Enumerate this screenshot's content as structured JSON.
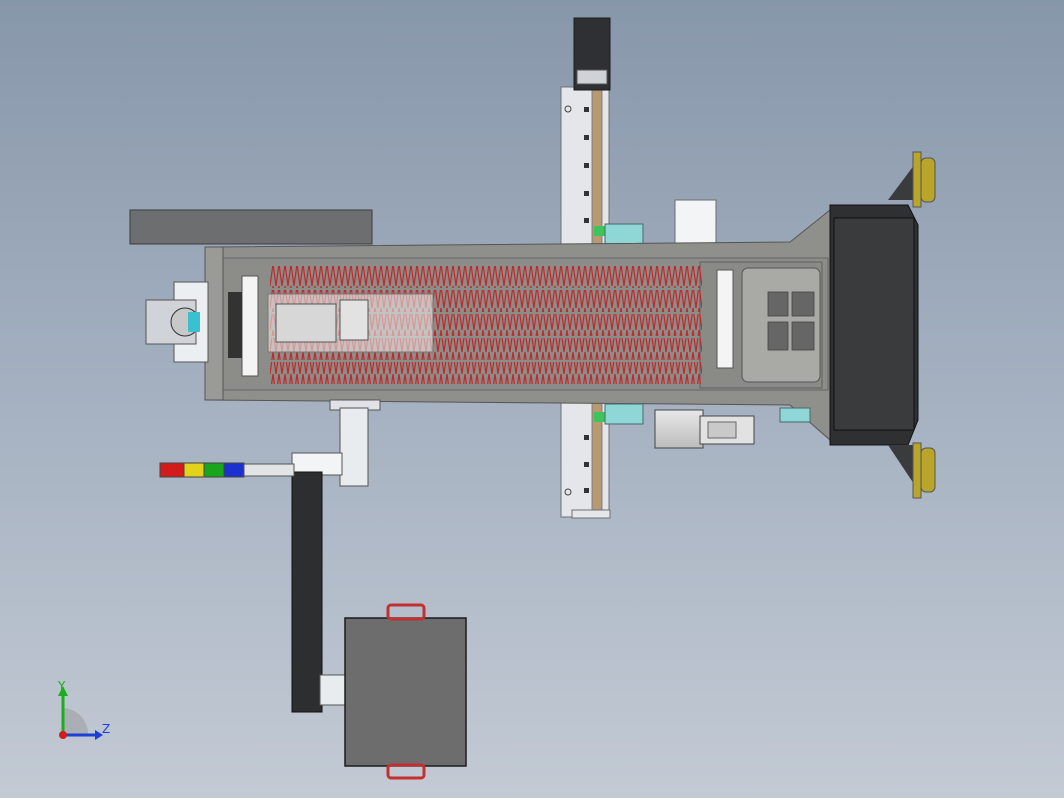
{
  "viewport": {
    "background_top": "#8797aa",
    "background_bottom": "#c3cad4"
  },
  "model": {
    "coil_color": "#c0292b",
    "tower_light_colors": [
      "#d21b1b",
      "#e3d21a",
      "#19a61c",
      "#1c2fd0"
    ],
    "frame_color": "#8f8f8b",
    "dark_color": "#5b5d5f",
    "accent_color": "#8fd6d6",
    "foot_color": "#b8a52a"
  },
  "triad": {
    "y_label": "Y",
    "z_label": "Z",
    "y_color": "#19b01c",
    "z_color": "#1e3fd6",
    "x_color": "#d21b1b"
  }
}
